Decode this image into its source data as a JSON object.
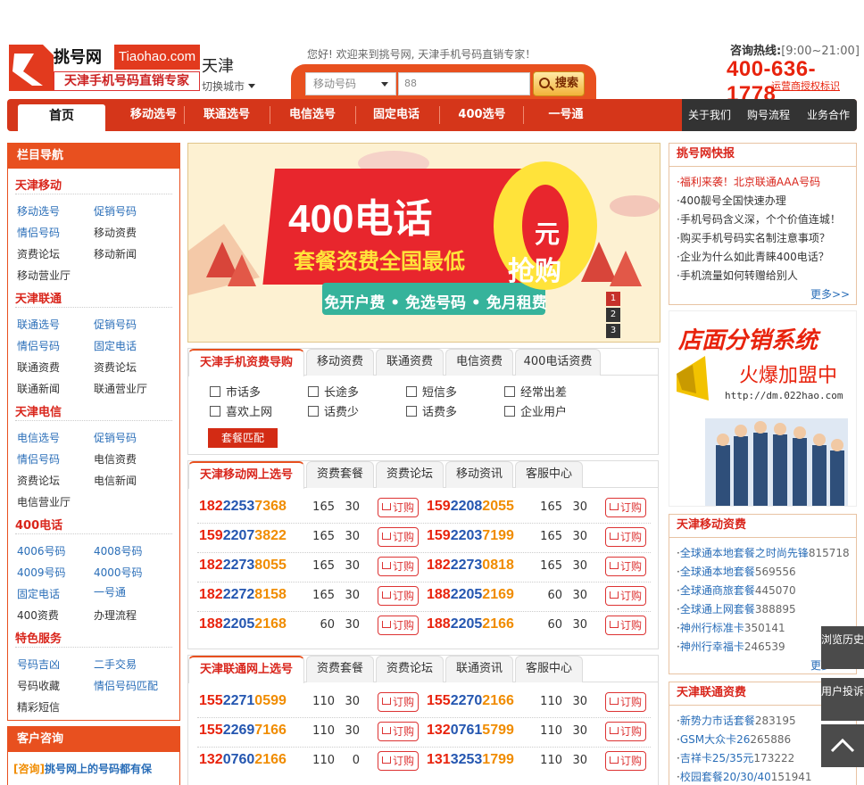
{
  "header": {
    "logo_cn": "挑号网",
    "logo_en": "Tiaohao.com",
    "logo_slogan": "天津手机号码直销专家",
    "city": "天津",
    "switch_city": "切换城市",
    "welcome": "您好! 欢迎来到挑号网, 天津手机号码直销专家！",
    "search_type": "移动号码",
    "search_value": "88",
    "search_button": "搜索",
    "hotline_label": "咨询热线:",
    "hotline_hours": "[9:00~21:00]",
    "hotline": "400-636-1778",
    "hotline_sub": "运营商授权标识"
  },
  "nav": {
    "home": "首页",
    "items": [
      "移动选号",
      "联通选号",
      "电信选号",
      "固定电话",
      "400选号",
      "一号通"
    ],
    "right": [
      "关于我们",
      "购号流程",
      "业务合作"
    ]
  },
  "leftnav": {
    "title": "栏目导航",
    "sections": [
      {
        "name": "天津移动",
        "links": [
          "移动选号",
          "促销号码",
          "情侣号码",
          "移动资费",
          "资费论坛",
          "移动新闻",
          "移动营业厅"
        ]
      },
      {
        "name": "天津联通",
        "links": [
          "联通选号",
          "促销号码",
          "情侣号码",
          "固定电话",
          "联通资费",
          "资费论坛",
          "联通新闻",
          "联通营业厅"
        ]
      },
      {
        "name": "天津电信",
        "links": [
          "电信选号",
          "促销号码",
          "情侣号码",
          "电信资费",
          "资费论坛",
          "电信新闻",
          "电信营业厅"
        ]
      },
      {
        "name": "400电话",
        "links": [
          "4006号码",
          "4008号码",
          "4009号码",
          "4000号码",
          "固定电话",
          "一号通",
          "400资费",
          "办理流程"
        ]
      },
      {
        "name": "特色服务",
        "links": [
          "号码吉凶",
          "二手交易",
          "号码收藏",
          "情侣号码匹配",
          "精彩短信"
        ]
      }
    ],
    "consult_title": "客户咨询",
    "consult_tag": "[咨询]",
    "consult_text": "挑号网上的号码都有保"
  },
  "banner": {
    "line1": "400电话",
    "big": "0",
    "yuan": "元",
    "grab": "抢购",
    "line2": "套餐资费全国最低",
    "ribbon": "免开户费 • 免选号码 • 免月租费",
    "dots": [
      "1",
      "2",
      "3"
    ]
  },
  "tariff_panel": {
    "tabs": [
      "天津手机资费导购",
      "移动资费",
      "联通资费",
      "电信资费",
      "400电话资费"
    ],
    "options": [
      "市话多",
      "长途多",
      "短信多",
      "经常出差",
      "喜欢上网",
      "话费少",
      "话费多",
      "企业用户"
    ],
    "button": "套餐匹配"
  },
  "mobile_panel": {
    "tabs": [
      "天津移动网上选号",
      "资费套餐",
      "资费论坛",
      "移动资讯",
      "客服中心"
    ],
    "rows": [
      [
        {
          "r": "182",
          "b": "2253",
          "o": "7368",
          "p": "165",
          "m": "30"
        },
        {
          "r": "159",
          "b": "2208",
          "o": "2055",
          "p": "165",
          "m": "30"
        }
      ],
      [
        {
          "r": "159",
          "b": "2207",
          "o": "3822",
          "p": "165",
          "m": "30"
        },
        {
          "r": "159",
          "b": "2203",
          "o": "7199",
          "p": "165",
          "m": "30"
        }
      ],
      [
        {
          "r": "182",
          "b": "2273",
          "o": "8055",
          "p": "165",
          "m": "30"
        },
        {
          "r": "182",
          "b": "2273",
          "o": "0818",
          "p": "165",
          "m": "30"
        }
      ],
      [
        {
          "r": "182",
          "b": "2272",
          "o": "8158",
          "p": "165",
          "m": "30"
        },
        {
          "r": "188",
          "b": "2205",
          "o": "2169",
          "p": "60",
          "m": "30"
        }
      ],
      [
        {
          "r": "188",
          "b": "2205",
          "o": "2168",
          "p": "60",
          "m": "30"
        },
        {
          "r": "188",
          "b": "2205",
          "o": "2166",
          "p": "60",
          "m": "30"
        }
      ]
    ],
    "buy_label": "订购"
  },
  "unicom_panel": {
    "tabs": [
      "天津联通网上选号",
      "资费套餐",
      "资费论坛",
      "联通资讯",
      "客服中心"
    ],
    "rows": [
      [
        {
          "r": "155",
          "b": "2271",
          "o": "0599",
          "p": "110",
          "m": "30"
        },
        {
          "r": "155",
          "b": "2270",
          "o": "2166",
          "p": "110",
          "m": "30"
        }
      ],
      [
        {
          "r": "155",
          "b": "2269",
          "o": "7166",
          "p": "110",
          "m": "30"
        },
        {
          "r": "132",
          "b": "0761",
          "o": "5799",
          "p": "110",
          "m": "30"
        }
      ],
      [
        {
          "r": "132",
          "b": "0760",
          "o": "2166",
          "p": "110",
          "m": "0"
        },
        {
          "r": "131",
          "b": "3253",
          "o": "1799",
          "p": "110",
          "m": "30"
        }
      ]
    ],
    "buy_label": "订购"
  },
  "news": {
    "title": "挑号网快报",
    "items": [
      "福利来袭！北京联通AAA号码",
      "400靓号全国快速办理",
      "手机号码含义深，个个价值连城！",
      "购买手机号码实名制注意事项？",
      "企业为什么如此青睐400电话？",
      "手机流量如何转赠给别人"
    ],
    "more": "更多>>"
  },
  "ad": {
    "title": "店面分销系统",
    "subtitle": "火爆加盟中",
    "url": "http://dm.022hao.com"
  },
  "mobile_tariff": {
    "title": "天津移动资费",
    "items": [
      {
        "name": "全球通本地套餐之时尚先锋",
        "id": "815718"
      },
      {
        "name": "全球通本地套餐",
        "id": "569556"
      },
      {
        "name": "全球通商旅套餐",
        "id": "445070"
      },
      {
        "name": "全球通上网套餐",
        "id": "388895"
      },
      {
        "name": "神州行标准卡",
        "id": "350141"
      },
      {
        "name": "神州行幸福卡",
        "id": "246539"
      }
    ],
    "more": "更多>>"
  },
  "unicom_tariff": {
    "title": "天津联通资费",
    "items": [
      {
        "name": "新势力市话套餐",
        "id": "283195"
      },
      {
        "name": "GSM大众卡26",
        "id": "265886"
      },
      {
        "name": "吉祥卡25/35元",
        "id": "173222"
      },
      {
        "name": "校园套餐20/30/40",
        "id": "151941"
      }
    ]
  },
  "floating": {
    "history": "浏览历史",
    "feedback": "用户投诉"
  },
  "colors": {
    "brand": "#e8501f",
    "red": "#e8230d",
    "blue": "#2456b0",
    "orange": "#f08c00"
  }
}
